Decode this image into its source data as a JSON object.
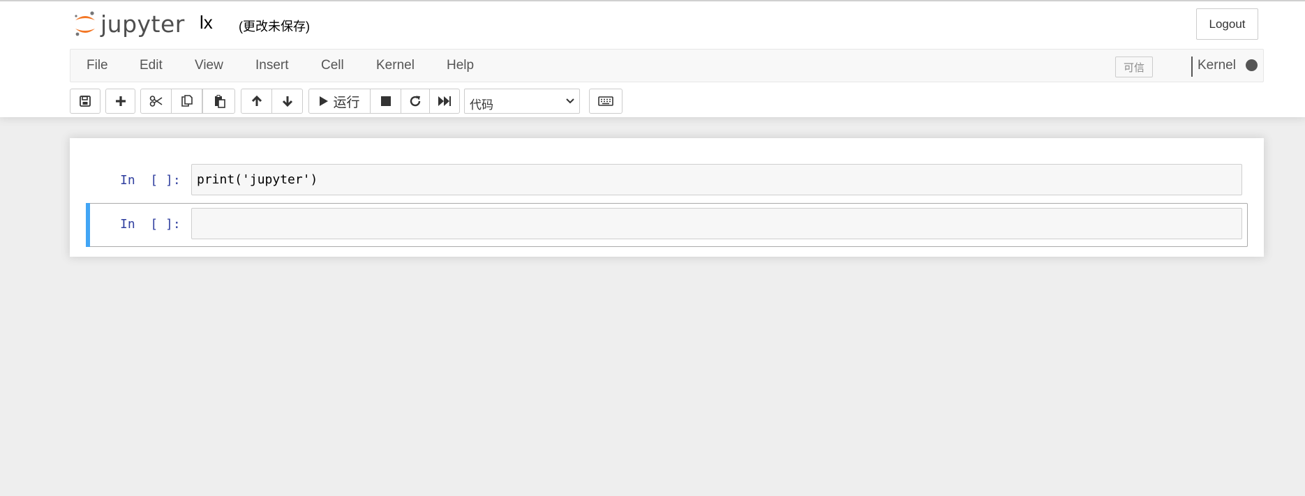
{
  "header": {
    "logo_text": "jupyter",
    "notebook_name": "lx",
    "save_status": "(更改未保存)",
    "logout_label": "Logout",
    "logo_colors": {
      "arc": "#f37726",
      "dots": "#767677",
      "text": "#4e4e4e"
    }
  },
  "menubar": {
    "items": [
      {
        "label": "File"
      },
      {
        "label": "Edit"
      },
      {
        "label": "View"
      },
      {
        "label": "Insert"
      },
      {
        "label": "Cell"
      },
      {
        "label": "Kernel"
      },
      {
        "label": "Help"
      }
    ],
    "trusted_label": "可信",
    "kernel_name": "Kernel",
    "kernel_status": "idle"
  },
  "toolbar": {
    "buttons": [
      {
        "icon": "save-icon"
      },
      {
        "icon": "plus-icon"
      },
      {
        "icon": "scissors-icon"
      },
      {
        "icon": "copy-icon"
      },
      {
        "icon": "paste-icon"
      },
      {
        "icon": "arrow-up-icon"
      },
      {
        "icon": "arrow-down-icon"
      },
      {
        "icon": "play-icon",
        "label": "运行"
      },
      {
        "icon": "stop-icon"
      },
      {
        "icon": "restart-icon"
      },
      {
        "icon": "fast-forward-icon"
      },
      {
        "icon": "keyboard-icon"
      }
    ],
    "run_label": "运行",
    "cell_type_selected": "代码"
  },
  "cells": [
    {
      "prompt": "In  [ ]:",
      "code": "print('jupyter')",
      "selected": false
    },
    {
      "prompt": "In  [ ]:",
      "code": "",
      "selected": true
    }
  ],
  "colors": {
    "selected_bar": "#42a5f5",
    "prompt": "#303f9f",
    "background": "#eeeeee"
  }
}
